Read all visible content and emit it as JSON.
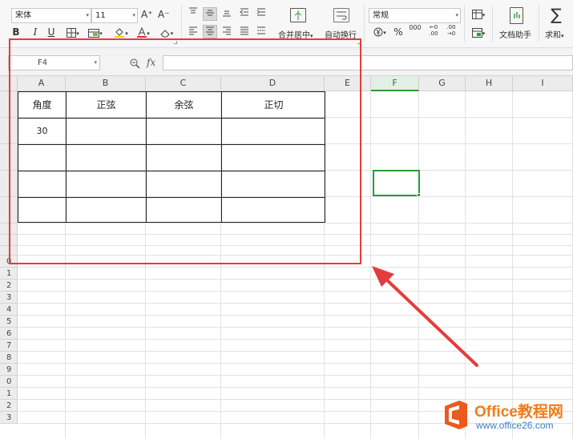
{
  "ribbon": {
    "font_name": "宋体",
    "font_size": "11",
    "grow_font": "A⁺",
    "shrink_font": "A⁻",
    "bold": "B",
    "italic": "I",
    "underline": "U",
    "merge_center_label": "合并居中",
    "wrap_text_label": "自动换行",
    "number_format": "常规",
    "percent": "%",
    "thousands": "000",
    "inc_decimal": "←0\n.00",
    "dec_decimal": ".00\n→0",
    "doc_helper_label": "文档助手",
    "sum_label": "求和",
    "sum_symbol": "∑",
    "dropdown_glyph": "▾",
    "menu_glyph": "▾"
  },
  "formula_bar": {
    "name_box": "F4",
    "fx_label": "fx"
  },
  "columns": [
    "A",
    "B",
    "C",
    "D",
    "E",
    "F",
    "G",
    "H",
    "I"
  ],
  "active_column": "F",
  "row_labels": [
    "0",
    "1",
    "2",
    "3",
    "4",
    "5",
    "6",
    "7",
    "8",
    "9",
    "0",
    "1",
    "2",
    "3"
  ],
  "table": {
    "headers": [
      "角度",
      "正弦",
      "余弦",
      "正切"
    ],
    "row1": [
      "30",
      "",
      "",
      ""
    ]
  },
  "watermark": {
    "title": "Office教程网",
    "url": "www.office26.com"
  },
  "colors": {
    "annotation": "#e43c3c",
    "active": "#2e9a3a",
    "watermark_orange": "#ef7d1a",
    "watermark_blue": "#3a7fc1"
  }
}
